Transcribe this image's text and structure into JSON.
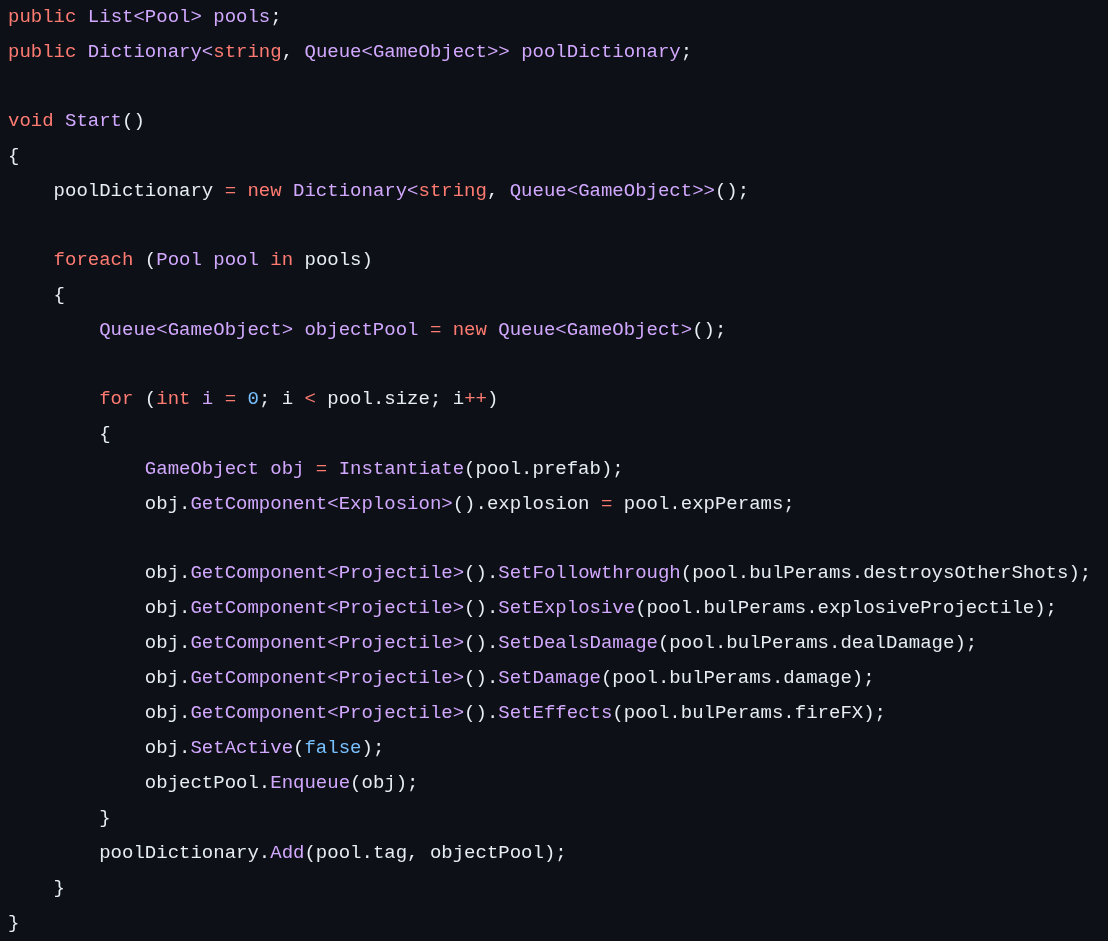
{
  "code_lines": [
    {
      "kind": "code",
      "tokens": [
        {
          "kind": "kw",
          "text": "public "
        },
        {
          "kind": "type",
          "text": "List<Pool> "
        },
        {
          "kind": "type",
          "text": "pools"
        },
        {
          "kind": "plain",
          "text": ";"
        }
      ]
    },
    {
      "kind": "code",
      "tokens": [
        {
          "kind": "kw",
          "text": "public "
        },
        {
          "kind": "type",
          "text": "Dictionary<"
        },
        {
          "kind": "kw",
          "text": "string"
        },
        {
          "kind": "plain",
          "text": ", "
        },
        {
          "kind": "type",
          "text": "Queue<GameObject>> "
        },
        {
          "kind": "type",
          "text": "poolDictionary"
        },
        {
          "kind": "plain",
          "text": ";"
        }
      ]
    },
    {
      "kind": "blank"
    },
    {
      "kind": "code",
      "tokens": [
        {
          "kind": "kw",
          "text": "void "
        },
        {
          "kind": "type",
          "text": "Start"
        },
        {
          "kind": "plain",
          "text": "()"
        }
      ]
    },
    {
      "kind": "code",
      "tokens": [
        {
          "kind": "plain",
          "text": "{"
        }
      ]
    },
    {
      "kind": "code",
      "tokens": [
        {
          "kind": "plain",
          "text": "    poolDictionary "
        },
        {
          "kind": "kw",
          "text": "= "
        },
        {
          "kind": "kw",
          "text": "new "
        },
        {
          "kind": "type",
          "text": "Dictionary<"
        },
        {
          "kind": "kw",
          "text": "string"
        },
        {
          "kind": "plain",
          "text": ", "
        },
        {
          "kind": "type",
          "text": "Queue<GameObject>>"
        },
        {
          "kind": "plain",
          "text": "();"
        }
      ]
    },
    {
      "kind": "blank"
    },
    {
      "kind": "code",
      "tokens": [
        {
          "kind": "kw",
          "text": "    foreach"
        },
        {
          "kind": "plain",
          "text": " ("
        },
        {
          "kind": "type",
          "text": "Pool pool "
        },
        {
          "kind": "kw",
          "text": "in"
        },
        {
          "kind": "plain",
          "text": " pools)"
        }
      ]
    },
    {
      "kind": "code",
      "tokens": [
        {
          "kind": "plain",
          "text": "    {"
        }
      ]
    },
    {
      "kind": "code",
      "tokens": [
        {
          "kind": "type",
          "text": "        Queue<GameObject> "
        },
        {
          "kind": "type",
          "text": "objectPool "
        },
        {
          "kind": "kw",
          "text": "= "
        },
        {
          "kind": "kw",
          "text": "new "
        },
        {
          "kind": "type",
          "text": "Queue<GameObject>"
        },
        {
          "kind": "plain",
          "text": "();"
        }
      ]
    },
    {
      "kind": "blank"
    },
    {
      "kind": "code",
      "tokens": [
        {
          "kind": "kw",
          "text": "        for"
        },
        {
          "kind": "plain",
          "text": " ("
        },
        {
          "kind": "kw",
          "text": "int "
        },
        {
          "kind": "type",
          "text": "i "
        },
        {
          "kind": "kw",
          "text": "= "
        },
        {
          "kind": "num",
          "text": "0"
        },
        {
          "kind": "plain",
          "text": "; i "
        },
        {
          "kind": "kw",
          "text": "<"
        },
        {
          "kind": "plain",
          "text": " pool.size; i"
        },
        {
          "kind": "kw",
          "text": "++"
        },
        {
          "kind": "plain",
          "text": ")"
        }
      ]
    },
    {
      "kind": "code",
      "tokens": [
        {
          "kind": "plain",
          "text": "        {"
        }
      ]
    },
    {
      "kind": "code",
      "tokens": [
        {
          "kind": "type",
          "text": "            GameObject obj "
        },
        {
          "kind": "kw",
          "text": "= "
        },
        {
          "kind": "type",
          "text": "Instantiate"
        },
        {
          "kind": "plain",
          "text": "(pool.prefab);"
        }
      ]
    },
    {
      "kind": "code",
      "tokens": [
        {
          "kind": "plain",
          "text": "            obj."
        },
        {
          "kind": "type",
          "text": "GetComponent<Explosion>"
        },
        {
          "kind": "plain",
          "text": "().explosion "
        },
        {
          "kind": "kw",
          "text": "="
        },
        {
          "kind": "plain",
          "text": " pool.expPerams;"
        }
      ]
    },
    {
      "kind": "blank"
    },
    {
      "kind": "code",
      "tokens": [
        {
          "kind": "plain",
          "text": "            obj."
        },
        {
          "kind": "type",
          "text": "GetComponent<Projectile>"
        },
        {
          "kind": "plain",
          "text": "()."
        },
        {
          "kind": "type",
          "text": "SetFollowthrough"
        },
        {
          "kind": "plain",
          "text": "(pool.bulPerams.destroysOtherShots);"
        }
      ]
    },
    {
      "kind": "code",
      "tokens": [
        {
          "kind": "plain",
          "text": "            obj."
        },
        {
          "kind": "type",
          "text": "GetComponent<Projectile>"
        },
        {
          "kind": "plain",
          "text": "()."
        },
        {
          "kind": "type",
          "text": "SetExplosive"
        },
        {
          "kind": "plain",
          "text": "(pool.bulPerams.explosiveProjectile);"
        }
      ]
    },
    {
      "kind": "code",
      "tokens": [
        {
          "kind": "plain",
          "text": "            obj."
        },
        {
          "kind": "type",
          "text": "GetComponent<Projectile>"
        },
        {
          "kind": "plain",
          "text": "()."
        },
        {
          "kind": "type",
          "text": "SetDealsDamage"
        },
        {
          "kind": "plain",
          "text": "(pool.bulPerams.dealDamage);"
        }
      ]
    },
    {
      "kind": "code",
      "tokens": [
        {
          "kind": "plain",
          "text": "            obj."
        },
        {
          "kind": "type",
          "text": "GetComponent<Projectile>"
        },
        {
          "kind": "plain",
          "text": "()."
        },
        {
          "kind": "type",
          "text": "SetDamage"
        },
        {
          "kind": "plain",
          "text": "(pool.bulPerams.damage);"
        }
      ]
    },
    {
      "kind": "code",
      "tokens": [
        {
          "kind": "plain",
          "text": "            obj."
        },
        {
          "kind": "type",
          "text": "GetComponent<Projectile>"
        },
        {
          "kind": "plain",
          "text": "()."
        },
        {
          "kind": "type",
          "text": "SetEffects"
        },
        {
          "kind": "plain",
          "text": "(pool.bulPerams.fireFX);"
        }
      ]
    },
    {
      "kind": "code",
      "tokens": [
        {
          "kind": "plain",
          "text": "            obj."
        },
        {
          "kind": "type",
          "text": "SetActive"
        },
        {
          "kind": "plain",
          "text": "("
        },
        {
          "kind": "num",
          "text": "false"
        },
        {
          "kind": "plain",
          "text": ");"
        }
      ]
    },
    {
      "kind": "code",
      "tokens": [
        {
          "kind": "plain",
          "text": "            objectPool."
        },
        {
          "kind": "type",
          "text": "Enqueue"
        },
        {
          "kind": "plain",
          "text": "(obj);"
        }
      ]
    },
    {
      "kind": "code",
      "tokens": [
        {
          "kind": "plain",
          "text": "        }"
        }
      ]
    },
    {
      "kind": "code",
      "tokens": [
        {
          "kind": "plain",
          "text": "        poolDictionary."
        },
        {
          "kind": "type",
          "text": "Add"
        },
        {
          "kind": "plain",
          "text": "(pool.tag, objectPool);"
        }
      ]
    },
    {
      "kind": "code",
      "tokens": [
        {
          "kind": "plain",
          "text": "    }"
        }
      ]
    },
    {
      "kind": "code",
      "tokens": [
        {
          "kind": "plain",
          "text": "}"
        }
      ]
    }
  ]
}
